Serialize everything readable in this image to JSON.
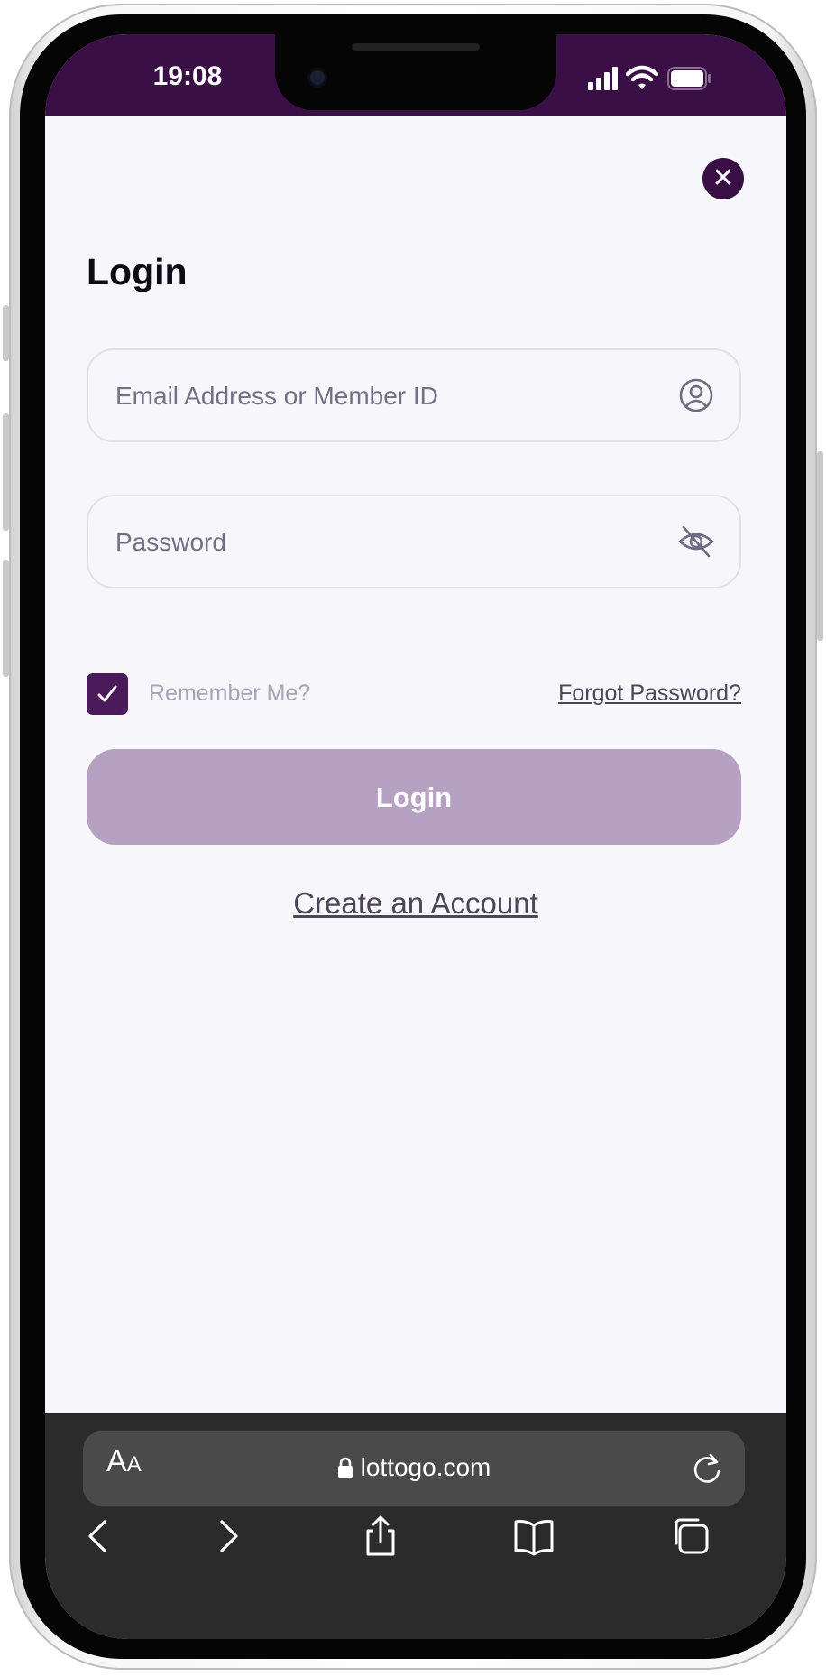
{
  "status": {
    "time": "19:08"
  },
  "login": {
    "title": "Login",
    "email_placeholder": "Email Address or Member ID",
    "password_placeholder": "Password",
    "remember_label": "Remember Me?",
    "remember_checked": true,
    "forgot_label": "Forgot Password?",
    "login_button": "Login",
    "create_account": "Create an Account"
  },
  "browser": {
    "font_size_label": "A",
    "font_size_label_small": "A",
    "url": "lottogo.com"
  },
  "colors": {
    "brand_purple": "#3a0f45",
    "button_disabled": "#b7a1c3",
    "background": "#f7f6fa"
  }
}
